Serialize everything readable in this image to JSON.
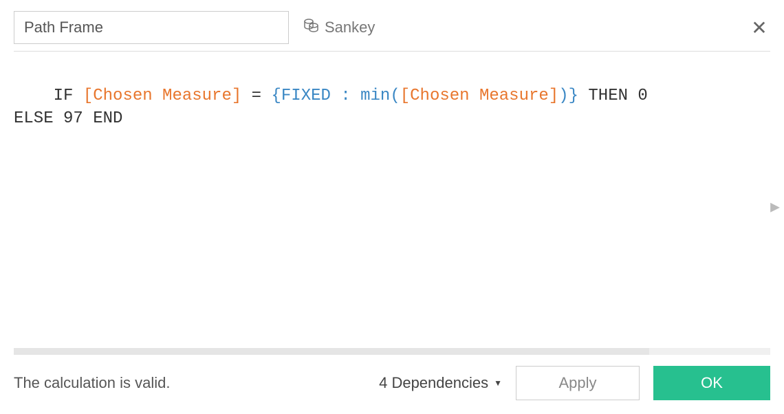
{
  "header": {
    "calc_name": "Path Frame",
    "datasource_label": "Sankey"
  },
  "formula": {
    "tokens": [
      {
        "text": "IF ",
        "cls": "tok-keyword"
      },
      {
        "text": "[Chosen Measure]",
        "cls": "tok-field"
      },
      {
        "text": " = ",
        "cls": "tok-op"
      },
      {
        "text": "{",
        "cls": "tok-brace"
      },
      {
        "text": "FIXED ",
        "cls": "tok-func"
      },
      {
        "text": ": ",
        "cls": "tok-func"
      },
      {
        "text": "min",
        "cls": "tok-func"
      },
      {
        "text": "(",
        "cls": "tok-func"
      },
      {
        "text": "[Chosen Measure]",
        "cls": "tok-field"
      },
      {
        "text": ")",
        "cls": "tok-func"
      },
      {
        "text": "}",
        "cls": "tok-brace"
      },
      {
        "text": " THEN ",
        "cls": "tok-keyword"
      },
      {
        "text": "0",
        "cls": "tok-number"
      },
      {
        "text": "\n",
        "cls": ""
      },
      {
        "text": "ELSE ",
        "cls": "tok-keyword"
      },
      {
        "text": "97",
        "cls": "tok-number"
      },
      {
        "text": " END",
        "cls": "tok-keyword"
      }
    ]
  },
  "footer": {
    "status": "The calculation is valid.",
    "dependencies_label": "4 Dependencies",
    "apply_label": "Apply",
    "ok_label": "OK"
  },
  "progress": {
    "percent": 84
  }
}
